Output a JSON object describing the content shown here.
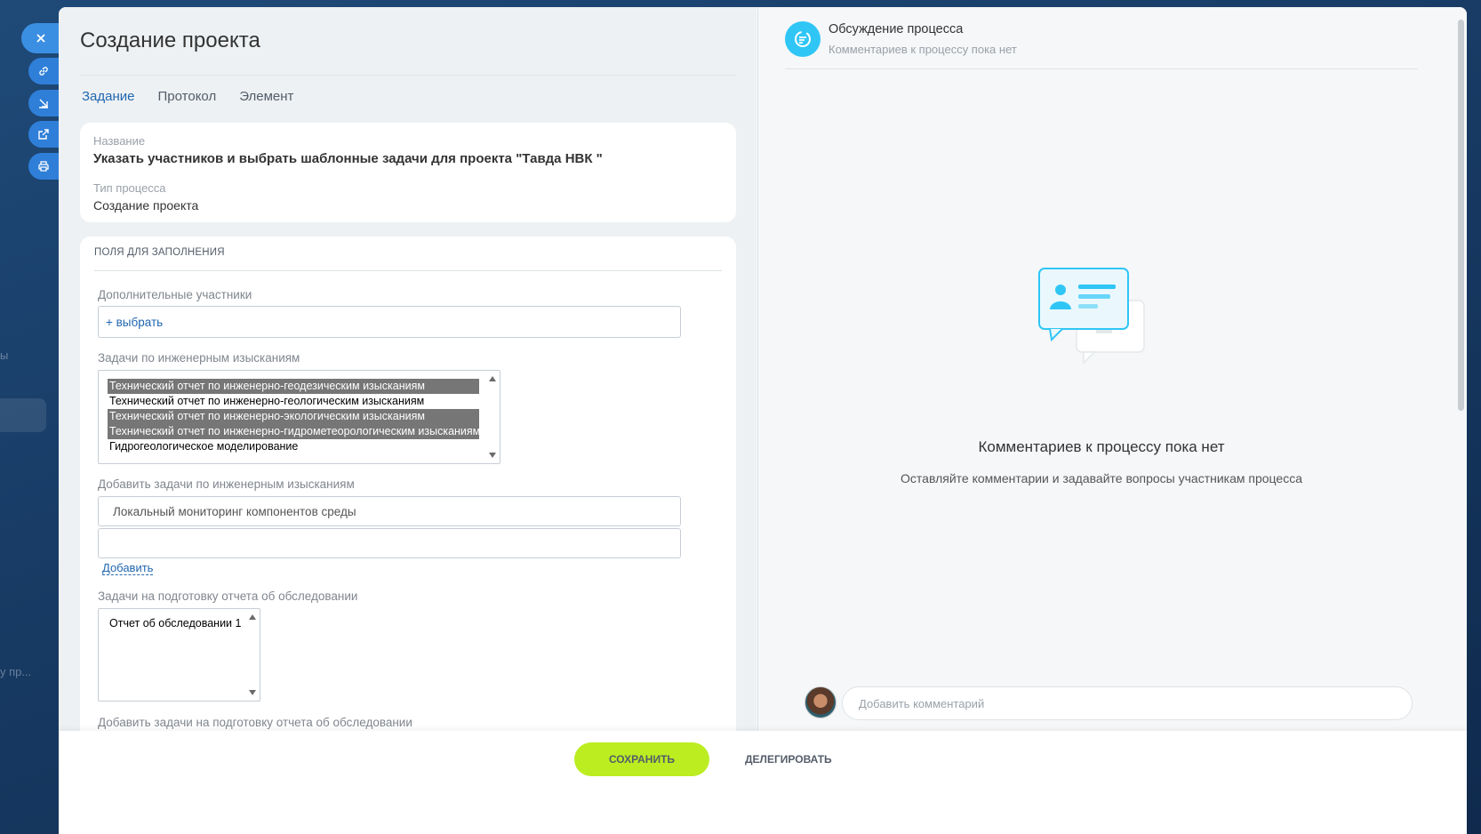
{
  "side_buttons": [
    "close-icon",
    "link-icon",
    "download-icon",
    "external-icon",
    "print-icon"
  ],
  "background_texts": [
    "ы",
    "у пр..."
  ],
  "left": {
    "title": "Создание проекта",
    "tabs": [
      {
        "label": "Задание",
        "active": true
      },
      {
        "label": "Протокол",
        "active": false
      },
      {
        "label": "Элемент",
        "active": false
      }
    ],
    "info": {
      "name_label": "Название",
      "name_value": "Указать участников и выбрать шаблонные задачи для проекта \"Тавда НВК \"",
      "type_label": "Тип процесса",
      "type_value": "Создание проекта"
    },
    "fields": {
      "section_title": "ПОЛЯ ДЛЯ ЗАПОЛНЕНИЯ",
      "participants_label": "Дополнительные участники",
      "participants_select": "+ выбрать",
      "survey_tasks_label": "Задачи по инженерным изысканиям",
      "survey_tasks_options": [
        {
          "text": "Технический отчет по инженерно-геодезическим изысканиям",
          "selected": true
        },
        {
          "text": "Технический отчет по инженерно-геологическим изысканиям",
          "selected": false
        },
        {
          "text": "Технический отчет по инженерно-экологическим изысканиям",
          "selected": true
        },
        {
          "text": "Технический отчет по инженерно-гидрометеорологическим изысканиям",
          "selected": true
        },
        {
          "text": "Гидрогеологическое моделирование",
          "selected": false
        }
      ],
      "add_survey_label": "Добавить задачи по инженерным изысканиям",
      "add_survey_value1": "Локальный мониторинг компонентов среды",
      "add_survey_value2": "",
      "add_link": "Добавить",
      "report_tasks_label": "Задачи на подготовку отчета об обследовании",
      "report_tasks_options": [
        {
          "text": "Отчет об обследовании 1",
          "selected": false
        }
      ],
      "add_report_label": "Добавить задачи на подготовку отчета об обследовании"
    }
  },
  "right": {
    "title": "Обсуждение процесса",
    "subtitle": "Комментариев к процессу пока нет",
    "empty_title": "Комментариев к процессу пока нет",
    "empty_subtitle": "Оставляйте комментарии и задавайте вопросы участникам процесса",
    "comment_placeholder": "Добавить комментарий"
  },
  "footer": {
    "save_label": "СОХРАНИТЬ",
    "delegate_label": "ДЕЛЕГИРОВАТЬ"
  },
  "colors": {
    "accent": "#2067b0",
    "save_button": "#bbed21",
    "discussion_icon": "#2fc6f6"
  }
}
